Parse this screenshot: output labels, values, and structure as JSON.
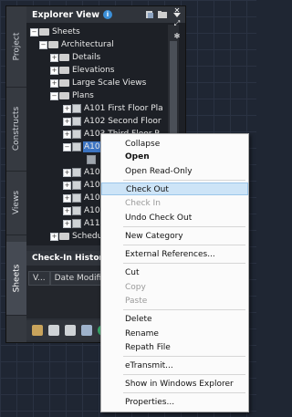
{
  "explorer": {
    "title": "Explorer View",
    "tree": [
      {
        "label": "Sheets",
        "level": 0
      },
      {
        "label": "Architectural",
        "level": 1
      },
      {
        "label": "Details",
        "level": 2
      },
      {
        "label": "Elevations",
        "level": 2
      },
      {
        "label": "Large Scale Views",
        "level": 2
      },
      {
        "label": "Plans",
        "level": 2
      },
      {
        "label": "A101 First Floor Pla",
        "level": 3
      },
      {
        "label": "A102 Second Floor",
        "level": 3
      },
      {
        "label": "A103 Third Floor P",
        "level": 3
      },
      {
        "label": "A10",
        "level": 3
      },
      {
        "label": "",
        "level": 4
      },
      {
        "label": "A10",
        "level": 3
      },
      {
        "label": "A10",
        "level": 3
      },
      {
        "label": "A10",
        "level": 3
      },
      {
        "label": "A10",
        "level": 3
      },
      {
        "label": "A11",
        "level": 3
      },
      {
        "label": "Schedu",
        "level": 2
      }
    ]
  },
  "side_tabs": [
    "Project",
    "Constructs",
    "Views",
    "Sheets"
  ],
  "checkin": {
    "title": "Check-In History",
    "columns": [
      "V...",
      "Date Modified"
    ]
  },
  "context_menu": {
    "items": [
      {
        "label": "Collapse",
        "style": "normal"
      },
      {
        "label": "Open",
        "style": "bold"
      },
      {
        "label": "Open Read-Only",
        "style": "normal"
      },
      {
        "label": "Check Out",
        "style": "hover"
      },
      {
        "label": "Check In",
        "style": "disabled"
      },
      {
        "label": "Undo Check Out",
        "style": "normal"
      },
      {
        "label": "New Category",
        "style": "normal"
      },
      {
        "label": "External References...",
        "style": "normal"
      },
      {
        "label": "Cut",
        "style": "normal"
      },
      {
        "label": "Copy",
        "style": "disabled"
      },
      {
        "label": "Paste",
        "style": "disabled"
      },
      {
        "label": "Delete",
        "style": "normal"
      },
      {
        "label": "Rename",
        "style": "normal"
      },
      {
        "label": "Repath File",
        "style": "normal"
      },
      {
        "label": "eTransmit...",
        "style": "normal"
      },
      {
        "label": "Show in Windows Explorer",
        "style": "normal"
      },
      {
        "label": "Properties...",
        "style": "normal"
      }
    ]
  },
  "colors": {
    "selection": "#3c74c2",
    "menu_hover": "#cde4f7",
    "info": "#3b8fd8"
  }
}
